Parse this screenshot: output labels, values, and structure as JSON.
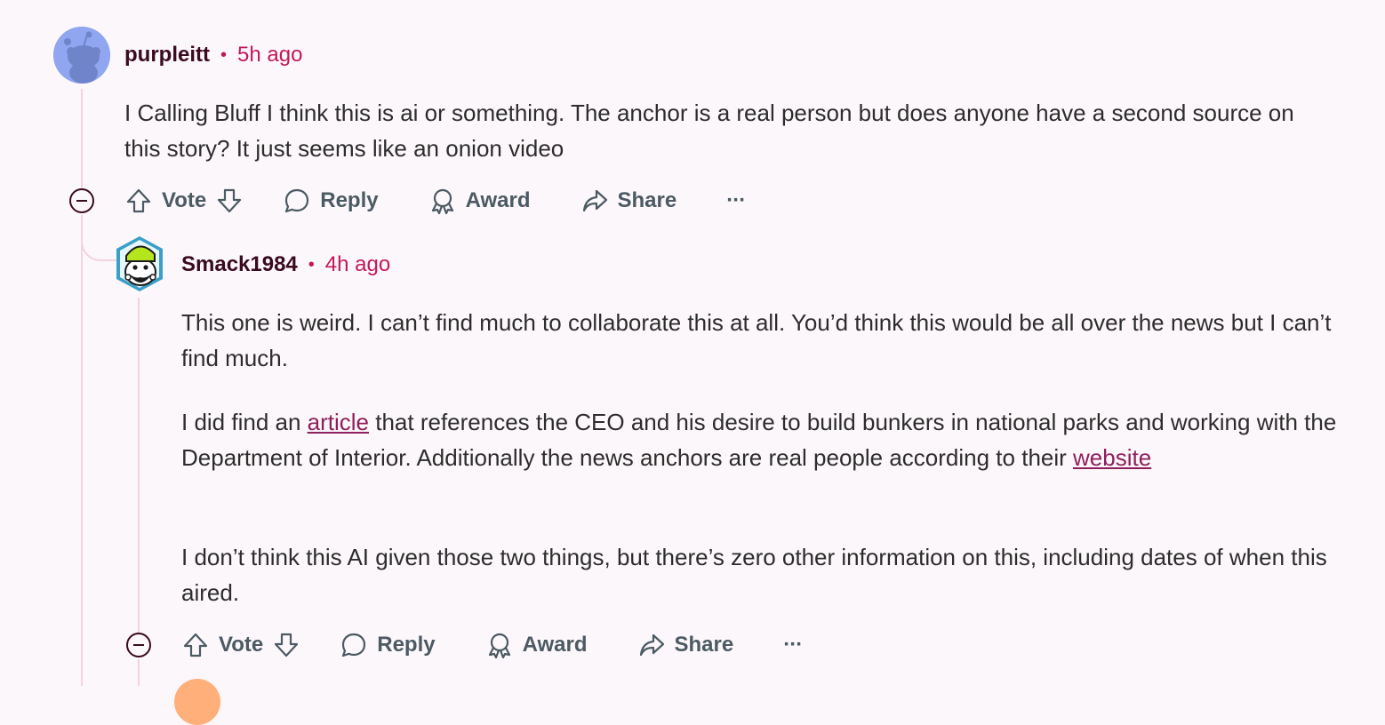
{
  "comment1": {
    "username": "purpleitt",
    "separator": "•",
    "time": "5h ago",
    "body": "I Calling Bluff I think this is ai or something. The anchor is a real person but does anyone have a second source on this story? It just seems like an onion video",
    "actions": {
      "vote": "Vote",
      "reply": "Reply",
      "award": "Award",
      "share": "Share",
      "more": "···"
    }
  },
  "comment2": {
    "username": "Smack1984",
    "separator": "•",
    "time": "4h ago",
    "p1": "This one is weird. I can’t find much to collaborate this at all. You’d think this would be all over the news but I can’t find much.",
    "p2_before": "I did find an ",
    "p2_link1": "article",
    "p2_middle": " that references the CEO and his desire to build bunkers in national parks and working with the Department of Interior. Additionally the news anchors are real people according to their ",
    "p2_link2": "website",
    "p3": "I don’t think this AI given those two things, but there’s zero other information on this, including dates of when this aired.",
    "actions": {
      "vote": "Vote",
      "reply": "Reply",
      "award": "Award",
      "share": "Share",
      "more": "···"
    }
  },
  "colors": {
    "background": "#fcf7fa",
    "username": "#3a0a1f",
    "time": "#c2185b",
    "link": "#8e1f5c",
    "action": "#4b5a63"
  }
}
